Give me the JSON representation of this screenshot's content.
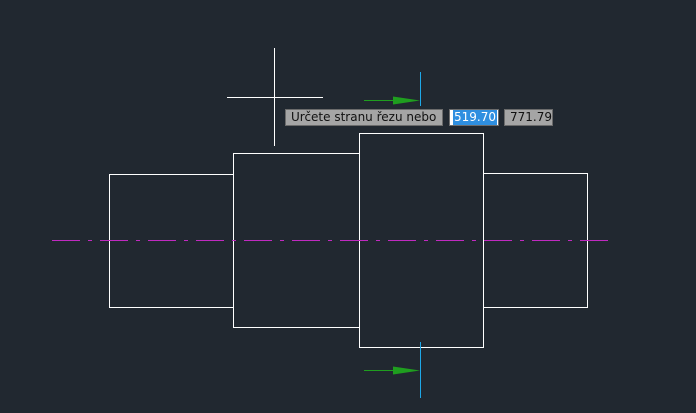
{
  "dynamic_input": {
    "prompt": "Určete stranu řezu nebo",
    "field_1_value": "519.70",
    "field_2_value": "771.79"
  },
  "colors": {
    "background": "#212830",
    "geometry": "#ffffff",
    "centerline": "#c02ac0",
    "section_line": "#1ea8e8",
    "arrows": "#1f9e1f",
    "crosshair": "#ffffff",
    "highlight": "#2f8fe0"
  },
  "icons": {
    "cursor": "crosshair-cursor-icon",
    "section_arrow": "direction-arrow-icon"
  }
}
